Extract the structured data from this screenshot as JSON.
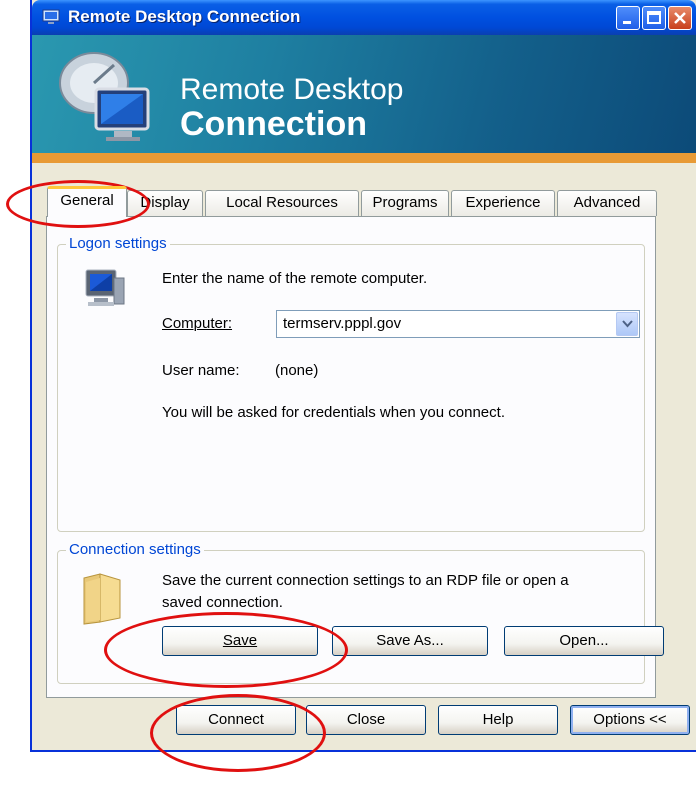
{
  "window": {
    "title": "Remote Desktop Connection"
  },
  "banner": {
    "line1": "Remote Desktop",
    "line2": "Connection"
  },
  "tabs": [
    {
      "label": "General",
      "active": true
    },
    {
      "label": "Display"
    },
    {
      "label": "Local Resources"
    },
    {
      "label": "Programs"
    },
    {
      "label": "Experience"
    },
    {
      "label": "Advanced"
    }
  ],
  "logon": {
    "group_label": "Logon settings",
    "instruction": "Enter the name of the remote computer.",
    "computer_label": "Computer:",
    "computer_value": "termserv.pppl.gov",
    "username_label": "User name:",
    "username_value": "(none)",
    "credentials_note": "You will be asked for credentials when you connect."
  },
  "connection": {
    "group_label": "Connection settings",
    "description_line1": "Save the current connection settings to an RDP file or open a",
    "description_line2": "saved connection.",
    "save_label": "Save",
    "save_as_label": "Save As...",
    "open_label": "Open..."
  },
  "footer": {
    "connect_label": "Connect",
    "close_label": "Close",
    "help_label": "Help",
    "options_label": "Options <<"
  },
  "annotations": {
    "color": "#e01010"
  }
}
